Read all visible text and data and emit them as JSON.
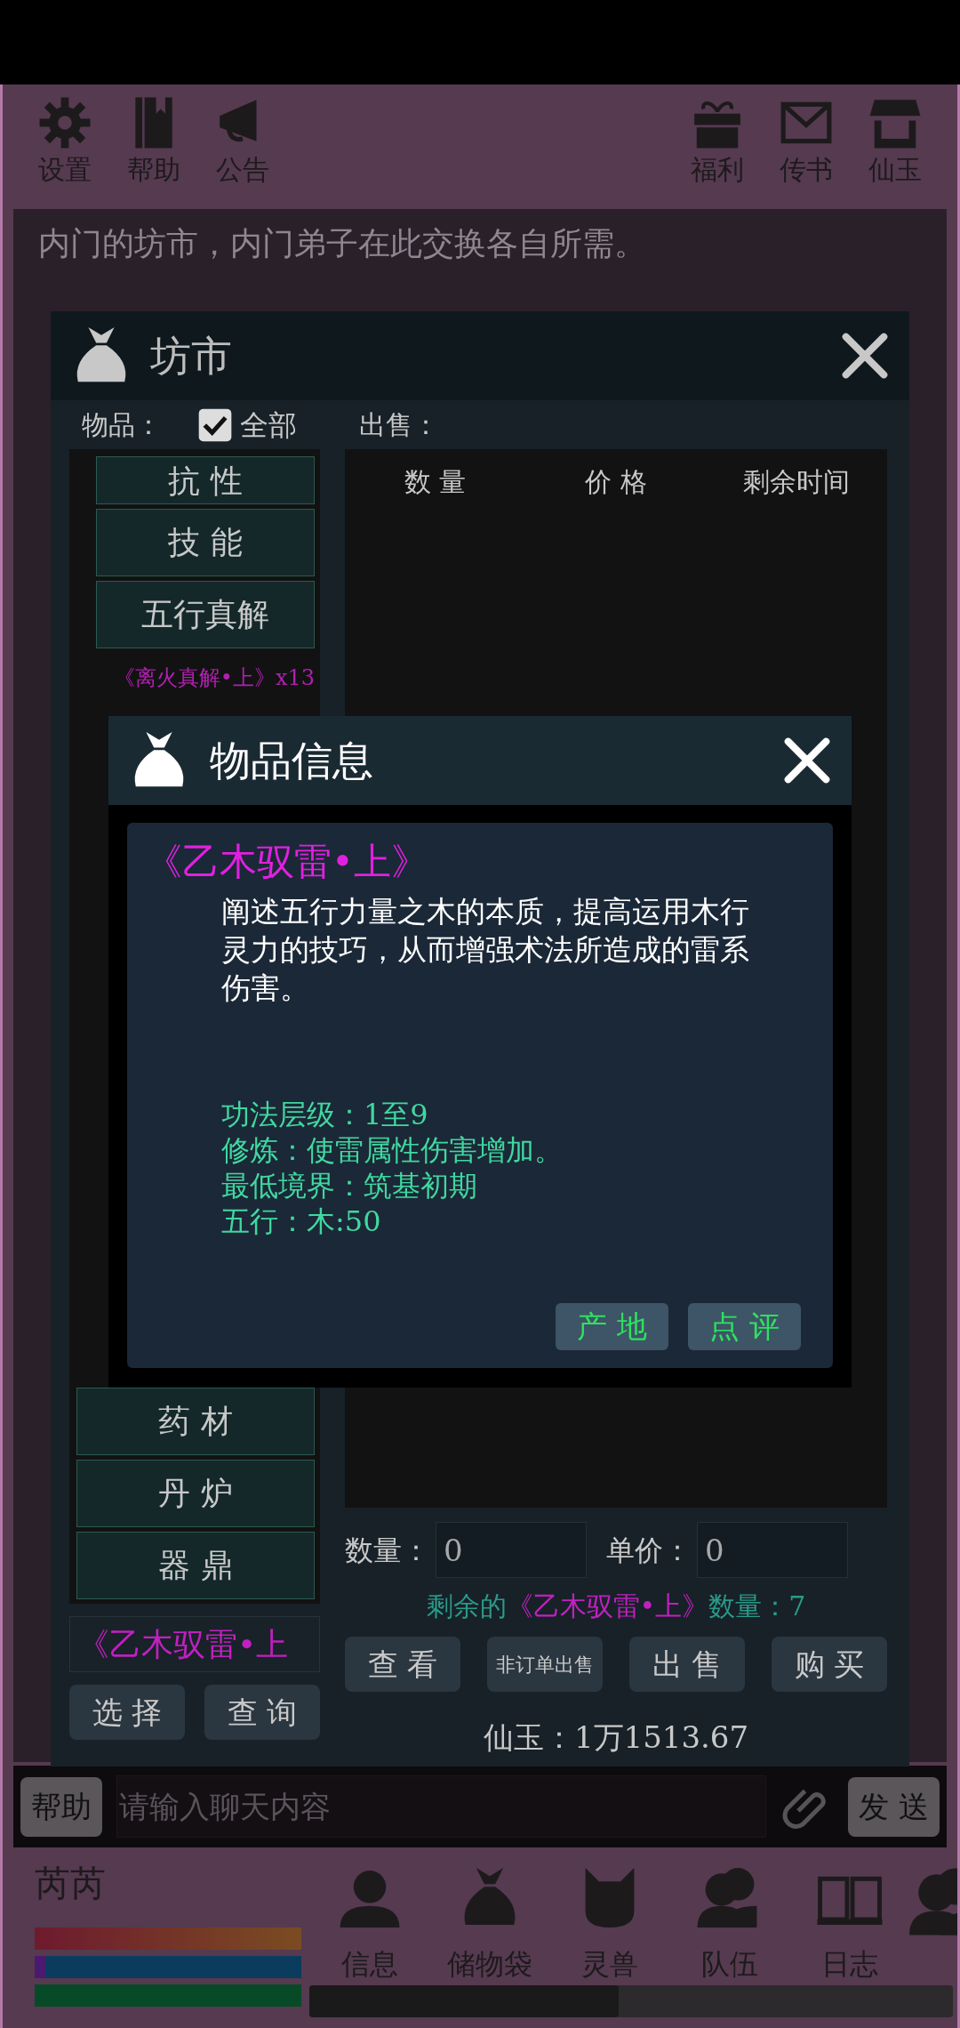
{
  "toolbar_left": [
    {
      "label": "设置"
    },
    {
      "label": "帮助"
    },
    {
      "label": "公告"
    }
  ],
  "toolbar_right": [
    {
      "label": "福利"
    },
    {
      "label": "传书"
    },
    {
      "label": "仙玉"
    }
  ],
  "location_text": "内门的坊市，内门弟子在此交换各自所需。",
  "market_dialog": {
    "title": "坊市",
    "items_label": "物品：",
    "all_checkbox": {
      "label": "全部",
      "checked": true
    },
    "sale_label": "出售：",
    "categories_top": [
      "抗 性",
      "技 能",
      "五行真解"
    ],
    "category_item": "《离火真解•上》x13",
    "categories_bottom": [
      "药 材",
      "丹 炉",
      "器 鼎"
    ],
    "selected_item": "《乙木驭雷•上",
    "select_button": "选 择",
    "query_button": "查 询",
    "table": {
      "columns": [
        "数 量",
        "价 格",
        "剩余时间"
      ]
    },
    "quantity_label": "数量：",
    "quantity_value": "0",
    "price_label": "单价：",
    "price_value": "0",
    "remaining_text": "剩余的**《乙木驭雷•上》**数量：7",
    "buttons": [
      "查 看",
      "非订单出售",
      "出 售",
      "购 买"
    ],
    "balance": "仙玉：1万1513.67"
  },
  "info_dialog": {
    "title": "物品信息",
    "item_name": "《乙木驭雷•上》",
    "description": "阐述五行力量之木的本质，提高运用木行灵力的技巧，从而增强术法所造成的雷系伤害。",
    "stats": [
      "功法层级：1至9",
      "修炼：使雷属性伤害增加。",
      "最低境界：筑基初期",
      "五行：木:50"
    ],
    "buttons": [
      "产 地",
      "点 评"
    ]
  },
  "chat": {
    "help_button": "帮助",
    "placeholder": "请输入聊天内容",
    "send_button": "发 送"
  },
  "player": {
    "name": "芮芮",
    "bars": [
      {
        "level": 1
      },
      {
        "level": 0.04
      },
      {
        "level": 1
      }
    ]
  },
  "nav": [
    {
      "label": "信息"
    },
    {
      "label": "储物袋"
    },
    {
      "label": "灵兽"
    },
    {
      "label": "队伍"
    },
    {
      "label": "日志"
    }
  ]
}
